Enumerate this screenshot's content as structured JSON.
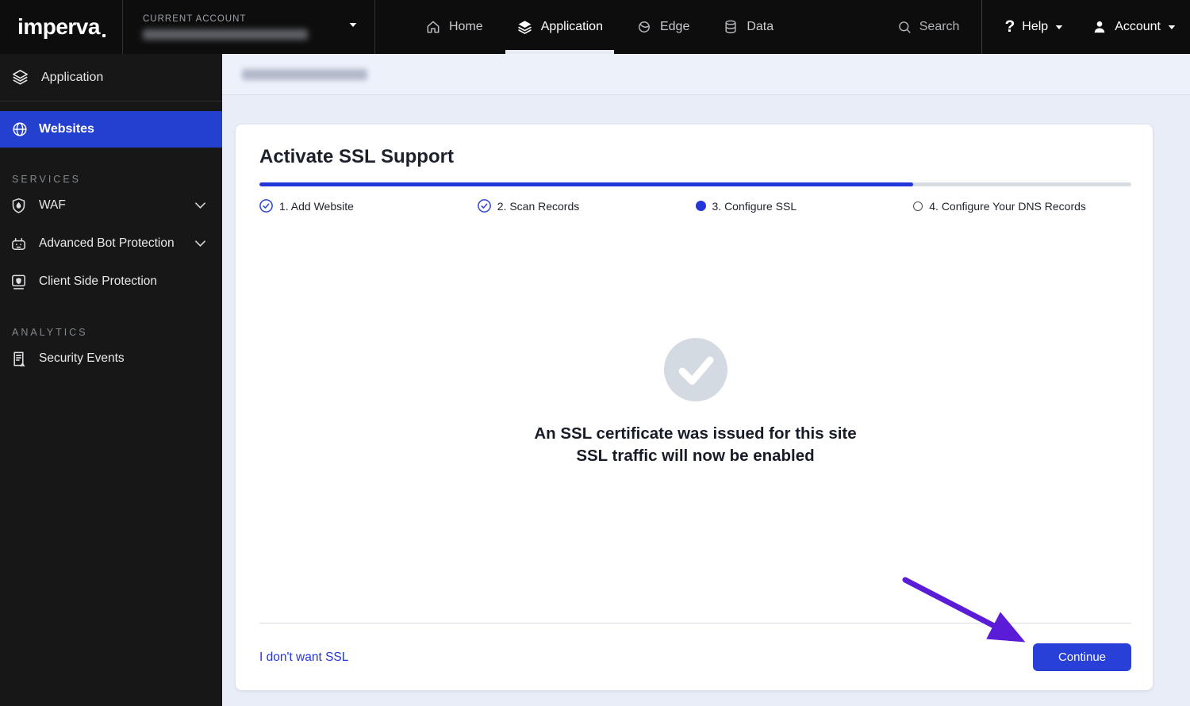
{
  "brand": {
    "logo_text": "imperva"
  },
  "topbar": {
    "current_account_label": "CURRENT ACCOUNT",
    "nav": [
      {
        "label": "Home",
        "icon": "home-icon",
        "active": false
      },
      {
        "label": "Application",
        "icon": "layers-icon",
        "active": true
      },
      {
        "label": "Edge",
        "icon": "planet-icon",
        "active": false
      },
      {
        "label": "Data",
        "icon": "database-icon",
        "active": false
      }
    ],
    "search_label": "Search",
    "help_label": "Help",
    "account_label": "Account"
  },
  "sidebar": {
    "top_item": {
      "label": "Application",
      "icon": "layers-icon"
    },
    "active_item": {
      "label": "Websites",
      "icon": "globe-icon"
    },
    "sections": [
      {
        "title": "SERVICES",
        "items": [
          {
            "label": "WAF",
            "icon": "shield-flame-icon",
            "expandable": true
          },
          {
            "label": "Advanced Bot Protection",
            "icon": "robot-icon",
            "expandable": true
          },
          {
            "label": "Client Side Protection",
            "icon": "browser-shield-icon",
            "expandable": false
          }
        ]
      },
      {
        "title": "ANALYTICS",
        "items": [
          {
            "label": "Security Events",
            "icon": "document-alert-icon",
            "expandable": false
          }
        ]
      }
    ]
  },
  "wizard": {
    "title": "Activate SSL Support",
    "progress_percent": 75,
    "steps": [
      {
        "label": "1. Add Website",
        "state": "completed"
      },
      {
        "label": "2. Scan Records",
        "state": "completed"
      },
      {
        "label": "3. Configure SSL",
        "state": "current"
      },
      {
        "label": "4. Configure Your DNS Records",
        "state": "pending"
      }
    ],
    "success_icon": "check-circle-icon",
    "message_line1": "An SSL certificate was issued for this site",
    "message_line2": "SSL traffic will now be enabled",
    "skip_link_label": "I don't want SSL",
    "continue_button_label": "Continue"
  },
  "annotations": {
    "arrow": "purple arrow pointing to Continue button"
  },
  "colors": {
    "accent_blue": "#2336d9",
    "active_nav_blue": "#2440cf",
    "button_blue": "#2840d8",
    "link_blue": "#2334e0",
    "arrow_purple": "#5a1cd6",
    "topbar_black": "#0d0d0d",
    "sidebar_black": "#171717",
    "page_background": "#e8edf7"
  }
}
